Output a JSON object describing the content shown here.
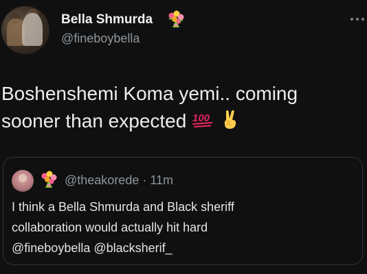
{
  "author": {
    "display_name": "Bella Shmurda",
    "handle": "@fineboybella",
    "badge_icon": "bouquet-emoji"
  },
  "more_icon": "ellipsis-icon",
  "tweet": {
    "line1": "Boshenshemi Koma yemi.. coming",
    "line2": "sooner than expected",
    "emojis": [
      "hundred-points-emoji",
      "victory-hand-emoji"
    ]
  },
  "quoted_tweet": {
    "badge_icon": "bouquet-emoji",
    "handle": "@theakorede",
    "separator": "·",
    "time": "11m",
    "line1": "I think a Bella Shmurda and Black sheriff",
    "line2": "collaboration would actually hit hard",
    "line3": "@fineboybella @blacksherif_"
  },
  "colors": {
    "background": "#101010",
    "text": "#eceeef",
    "secondary_text": "#8f979e",
    "border": "#2f3336",
    "hundred_red": "#e0245e"
  }
}
